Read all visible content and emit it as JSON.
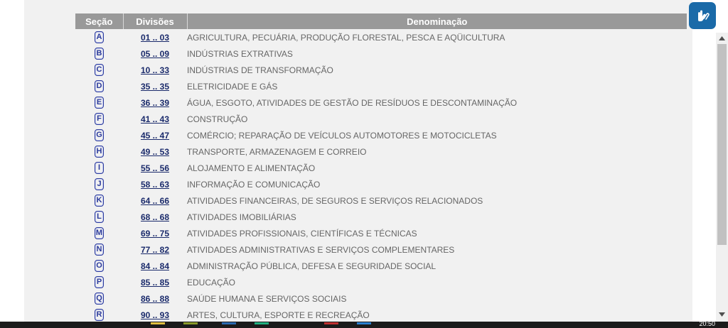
{
  "table": {
    "headers": {
      "section": "Seção",
      "divisions": "Divisões",
      "denomination": "Denominação"
    },
    "rows": [
      {
        "section": "A",
        "divisions": "01 .. 03",
        "denomination": "AGRICULTURA, PECUÁRIA, PRODUÇÃO FLORESTAL, PESCA E AQÜICULTURA"
      },
      {
        "section": "B",
        "divisions": "05 .. 09",
        "denomination": "INDÚSTRIAS EXTRATIVAS"
      },
      {
        "section": "C",
        "divisions": "10 .. 33",
        "denomination": "INDÚSTRIAS DE TRANSFORMAÇÃO"
      },
      {
        "section": "D",
        "divisions": "35 .. 35",
        "denomination": "ELETRICIDADE E GÁS"
      },
      {
        "section": "E",
        "divisions": "36 .. 39",
        "denomination": "ÁGUA, ESGOTO, ATIVIDADES DE GESTÃO DE RESÍDUOS E DESCONTAMINAÇÃO"
      },
      {
        "section": "F",
        "divisions": "41 .. 43",
        "denomination": "CONSTRUÇÃO"
      },
      {
        "section": "G",
        "divisions": "45 .. 47",
        "denomination": "COMÉRCIO; REPARAÇÃO DE VEÍCULOS AUTOMOTORES E MOTOCICLETAS"
      },
      {
        "section": "H",
        "divisions": "49 .. 53",
        "denomination": "TRANSPORTE, ARMAZENAGEM E CORREIO"
      },
      {
        "section": "I",
        "divisions": "55 .. 56",
        "denomination": "ALOJAMENTO E ALIMENTAÇÃO"
      },
      {
        "section": "J",
        "divisions": "58 .. 63",
        "denomination": "INFORMAÇÃO E COMUNICAÇÃO"
      },
      {
        "section": "K",
        "divisions": "64 .. 66",
        "denomination": "ATIVIDADES FINANCEIRAS, DE SEGUROS E SERVIÇOS RELACIONADOS"
      },
      {
        "section": "L",
        "divisions": "68 .. 68",
        "denomination": "ATIVIDADES IMOBILIÁRIAS"
      },
      {
        "section": "M",
        "divisions": "69 .. 75",
        "denomination": "ATIVIDADES PROFISSIONAIS, CIENTÍFICAS E TÉCNICAS"
      },
      {
        "section": "N",
        "divisions": "77 .. 82",
        "denomination": "ATIVIDADES ADMINISTRATIVAS E SERVIÇOS COMPLEMENTARES"
      },
      {
        "section": "O",
        "divisions": "84 .. 84",
        "denomination": "ADMINISTRAÇÃO PÚBLICA, DEFESA E SEGURIDADE SOCIAL"
      },
      {
        "section": "P",
        "divisions": "85 .. 85",
        "denomination": "EDUCAÇÃO"
      },
      {
        "section": "Q",
        "divisions": "86 .. 88",
        "denomination": "SAÚDE HUMANA E SERVIÇOS SOCIAIS"
      },
      {
        "section": "R",
        "divisions": "90 .. 93",
        "denomination": "ARTES, CULTURA, ESPORTE E RECREAÇÃO"
      }
    ]
  },
  "icons": {
    "accessibility": "sign-language-hands-icon",
    "scroll_up": "triangle-up-icon",
    "scroll_down": "triangle-down-icon"
  },
  "colors": {
    "header_bg": "#999999",
    "section_badge": "#2a3a9c",
    "division_link": "#1a2a6b",
    "denomination_text": "#666666",
    "accessibility_button": "#1a6aa8"
  },
  "taskbar": {
    "clock": "20:50"
  }
}
